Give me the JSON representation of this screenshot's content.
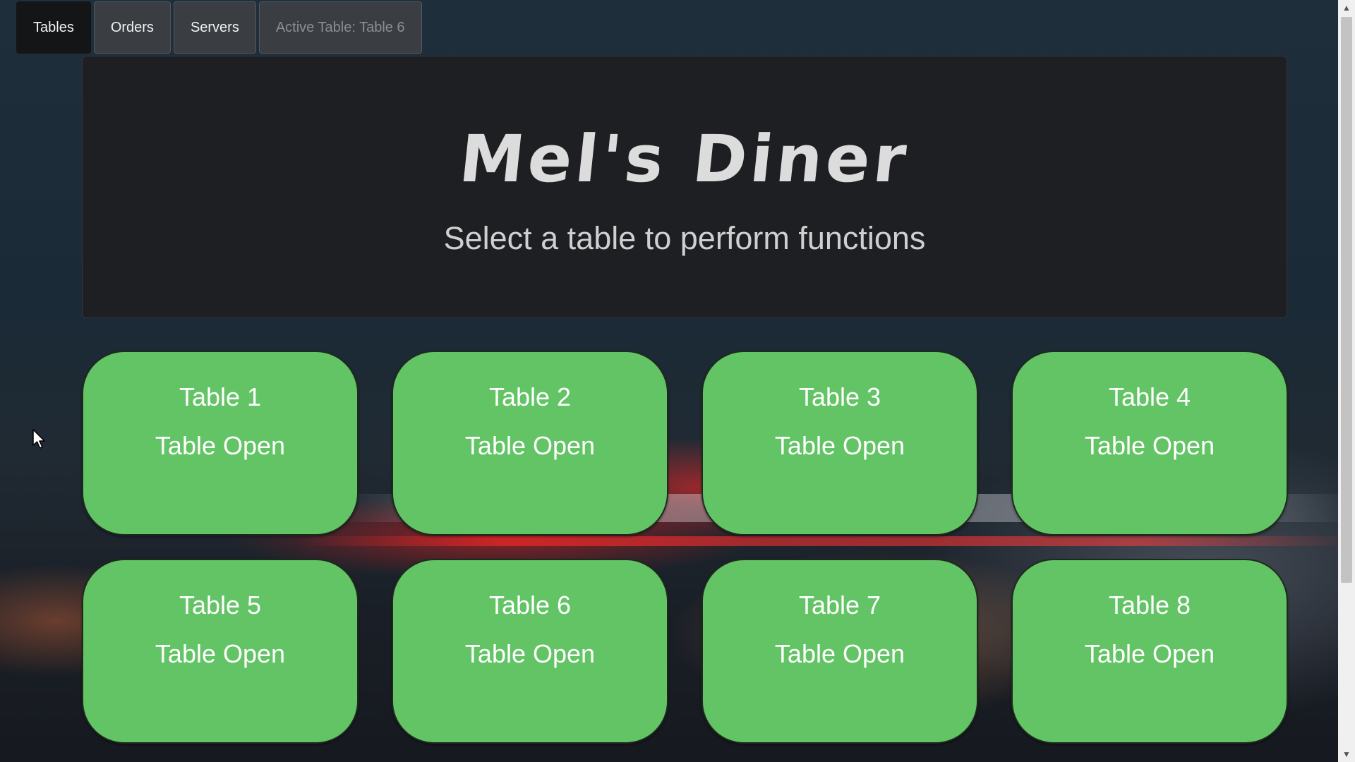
{
  "nav": {
    "items": [
      {
        "label": "Tables"
      },
      {
        "label": "Orders"
      },
      {
        "label": "Servers"
      },
      {
        "label": "Active Table: Table 6"
      }
    ]
  },
  "hero": {
    "title": "Mel's Diner",
    "subtitle": "Select a table to perform functions"
  },
  "tables": [
    {
      "name": "Table 1",
      "status": "Table Open"
    },
    {
      "name": "Table 2",
      "status": "Table Open"
    },
    {
      "name": "Table 3",
      "status": "Table Open"
    },
    {
      "name": "Table 4",
      "status": "Table Open"
    },
    {
      "name": "Table 5",
      "status": "Table Open"
    },
    {
      "name": "Table 6",
      "status": "Table Open"
    },
    {
      "name": "Table 7",
      "status": "Table Open"
    },
    {
      "name": "Table 8",
      "status": "Table Open"
    }
  ],
  "colors": {
    "table_open": "#63c466",
    "navbar_active": "#141517",
    "hero_background": "#1d1f23"
  },
  "icons": {
    "cursor": "mouse-pointer-icon",
    "scroll_up": "chevron-up-icon",
    "scroll_down": "chevron-down-icon"
  }
}
